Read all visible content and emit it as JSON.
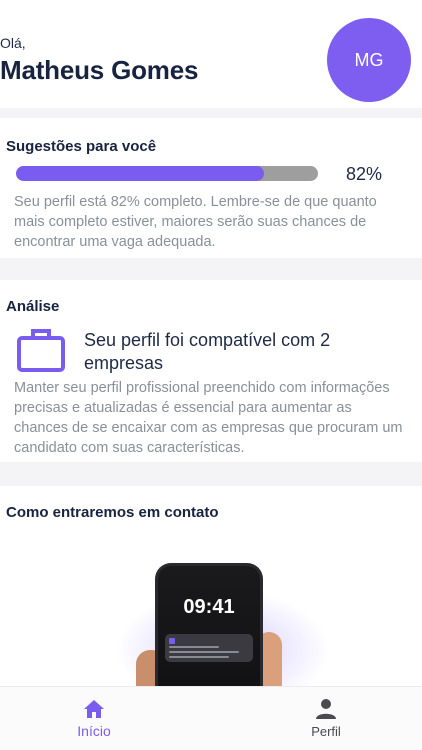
{
  "header": {
    "greeting": "Olá,",
    "user_name": "Matheus Gomes",
    "avatar_initials": "MG"
  },
  "suggestions": {
    "title": "Sugestões para você",
    "progress_percent": 82,
    "progress_label": "82%",
    "description": "Seu perfil está 82% completo. Lembre-se de que quanto mais completo estiver, maiores serão suas chances de encontrar uma vaga adequada."
  },
  "analysis": {
    "title": "Análise",
    "icon": "briefcase-icon",
    "match_text": "Seu perfil foi compatível com 2 empresas",
    "description": "Manter seu perfil profissional preenchido com informações precisas e atualizadas é essencial para aumentar as chances de se encaixar com as empresas que procuram um candidato com suas características."
  },
  "contact": {
    "title": "Como entraremos em contato",
    "phone_time": "09:41"
  },
  "tabbar": {
    "tabs": [
      {
        "label": "Início",
        "icon": "home-icon",
        "active": true
      },
      {
        "label": "Perfil",
        "icon": "user-icon",
        "active": false
      }
    ]
  },
  "colors": {
    "accent": "#7b5cf0",
    "avatar": "#7e5ef0",
    "text_dark": "#17233f",
    "text_muted": "#8a8f99"
  }
}
